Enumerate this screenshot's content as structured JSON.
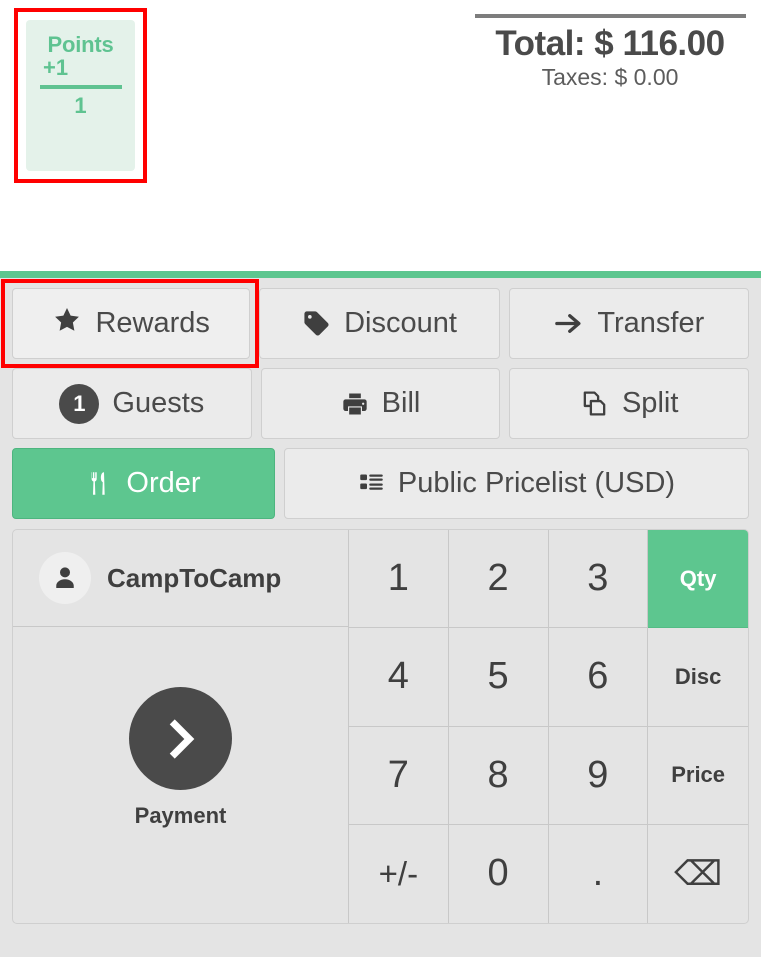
{
  "points": {
    "title": "Points",
    "delta": "+1",
    "total": "1",
    "accent_color": "#5fc391",
    "background_color": "#e4f2ea",
    "highlight_color": "#ff0000"
  },
  "totals": {
    "total_label": "Total: $ 116.00",
    "taxes_label": "Taxes: $ 0.00"
  },
  "theme": {
    "accent_green": "#5dc68f",
    "panel_background": "#e4e4e4",
    "button_background": "#ebebeb",
    "text_dark": "#4a4a4a",
    "highlight_red": "#ff0000"
  },
  "actions": {
    "row1": [
      {
        "label": "Rewards",
        "icon": "star-icon",
        "highlighted": true
      },
      {
        "label": "Discount",
        "icon": "tag-icon",
        "highlighted": false
      },
      {
        "label": "Transfer",
        "icon": "arrow-right-icon",
        "highlighted": false
      }
    ],
    "row2": [
      {
        "label": "Guests",
        "icon": "guest-count-badge",
        "badge": "1"
      },
      {
        "label": "Bill",
        "icon": "printer-icon"
      },
      {
        "label": "Split",
        "icon": "copy-icon"
      }
    ],
    "row3": [
      {
        "label": "Order",
        "icon": "cutlery-icon",
        "active": true
      },
      {
        "label": "Public Pricelist (USD)",
        "icon": "list-icon",
        "active": false
      }
    ]
  },
  "customer": {
    "name": "CampToCamp",
    "avatar_icon": "user-icon"
  },
  "payment": {
    "label": "Payment",
    "icon": "chevron-right-icon"
  },
  "keypad": {
    "keys": [
      {
        "label": "1",
        "type": "digit"
      },
      {
        "label": "2",
        "type": "digit"
      },
      {
        "label": "3",
        "type": "digit"
      },
      {
        "label": "Qty",
        "type": "mode",
        "active": true
      },
      {
        "label": "4",
        "type": "digit"
      },
      {
        "label": "5",
        "type": "digit"
      },
      {
        "label": "6",
        "type": "digit"
      },
      {
        "label": "Disc",
        "type": "mode",
        "active": false
      },
      {
        "label": "7",
        "type": "digit"
      },
      {
        "label": "8",
        "type": "digit"
      },
      {
        "label": "9",
        "type": "digit"
      },
      {
        "label": "Price",
        "type": "mode",
        "active": false
      },
      {
        "label": "+/-",
        "type": "sign"
      },
      {
        "label": "0",
        "type": "digit"
      },
      {
        "label": ".",
        "type": "digit"
      },
      {
        "label": "⌫",
        "type": "backspace",
        "icon": "backspace-icon"
      }
    ]
  }
}
